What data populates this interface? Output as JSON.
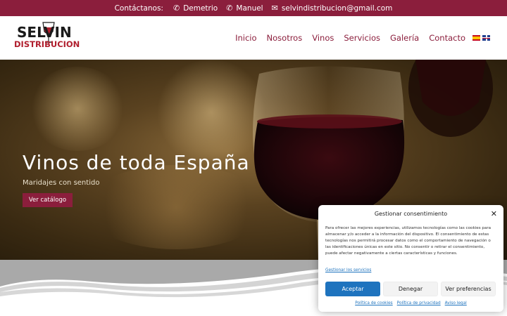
{
  "topbar": {
    "contact_label": "Contáctanos:",
    "phone1": "Demetrio",
    "phone2": "Manuel",
    "email": "selvindistribucion@gmail.com",
    "phone_icon": "phone-icon",
    "email_icon": "envelope-icon"
  },
  "logo": {
    "line1": "SELVIN",
    "line2": "DISTRIBUCION"
  },
  "nav": {
    "items": [
      "Inicio",
      "Nosotros",
      "Vinos",
      "Servicios",
      "Galería",
      "Contacto"
    ],
    "languages": [
      "es",
      "en"
    ]
  },
  "hero": {
    "title": "Vinos de toda España",
    "subtitle": "Maridajes con sentido",
    "button": "Ver catálogo"
  },
  "consent": {
    "title": "Gestionar consentimiento",
    "body": "Para ofrecer las mejores experiencias, utilizamos tecnologías como las cookies para almacenar y/o acceder a la información del dispositivo. El consentimiento de estas tecnologías nos permitirá procesar datos como el comportamiento de navegación o las identificaciones únicas en este sitio. No consentir o retirar el consentimiento, puede afectar negativamente a ciertas características y funciones.",
    "manage_link": "Gestionar los servicios",
    "accept": "Aceptar",
    "deny": "Denegar",
    "preferences": "Ver preferencias",
    "footer_links": [
      "Política de cookies",
      "Política de privacidad",
      "Aviso legal"
    ]
  },
  "colors": {
    "brand": "#8b1e3c",
    "link": "#1e73be",
    "accept_button": "#1e73be"
  }
}
